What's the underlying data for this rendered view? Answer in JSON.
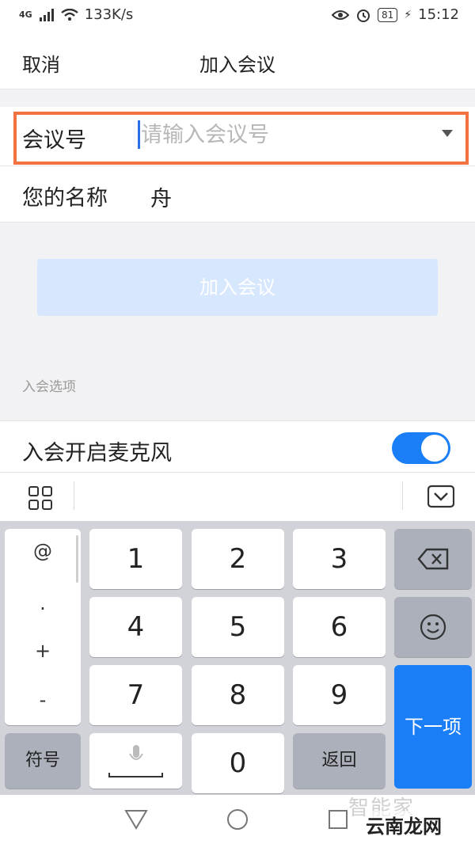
{
  "status_bar": {
    "network": "4G",
    "speed": "133K/s",
    "battery": "81",
    "time": "15:12"
  },
  "nav": {
    "cancel": "取消",
    "title": "加入会议"
  },
  "form": {
    "meeting_label": "会议号",
    "meeting_placeholder": "请输入会议号",
    "meeting_value": "",
    "name_label": "您的名称",
    "name_value": "舟"
  },
  "join_button": "加入会议",
  "options": {
    "header": "入会选项",
    "mic_label": "入会开启麦克风",
    "mic_enabled": true
  },
  "keyboard": {
    "symbols": [
      "@",
      ".",
      "+",
      "-"
    ],
    "digits": [
      "1",
      "2",
      "3",
      "4",
      "5",
      "6",
      "7",
      "8",
      "9",
      "0"
    ],
    "symbol_key": "符号",
    "back_key": "返回",
    "next_key": "下一项"
  },
  "watermark": {
    "top": "智能家",
    "bottom": "云南龙网"
  },
  "colors": {
    "accent": "#1a7ef7",
    "highlight_border": "#f37242",
    "join_button_bg": "#d6e7fe"
  }
}
